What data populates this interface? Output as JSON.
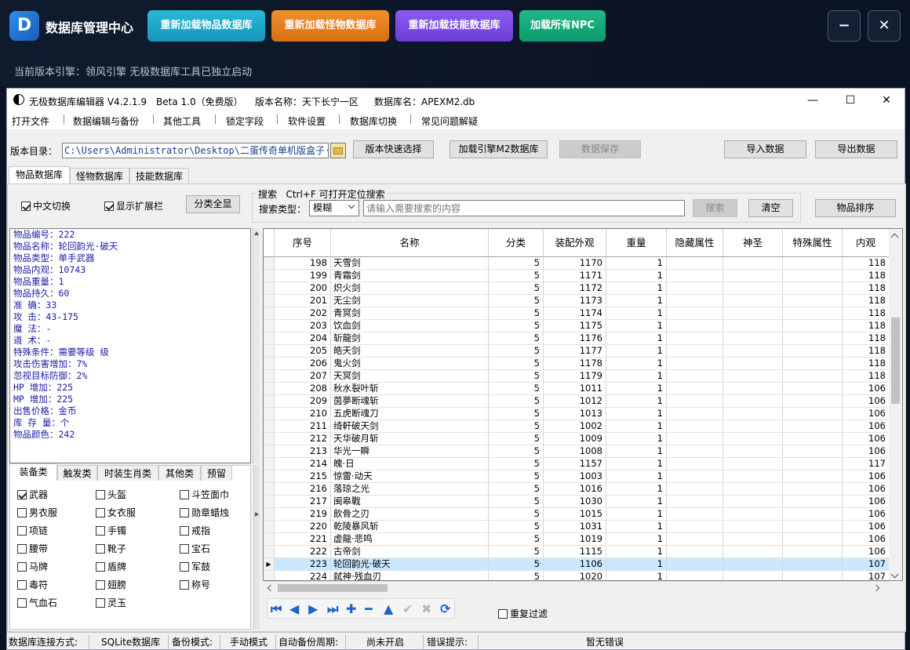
{
  "top": {
    "app_title": "数据库管理中心",
    "logo_letter": "D",
    "buttons": [
      "重新加载物品数据库",
      "重新加载怪物数据库",
      "重新加载技能数据库",
      "加载所有NPC"
    ],
    "minimize": "−",
    "close": "✕",
    "sub_text": "当前版本引擎：领风引擎    无极数据库工具已独立启动",
    "colors": {
      "btn1": "#1aa6c8",
      "btn2": "#e07b1f",
      "btn3": "#7a4ce0",
      "btn4": "#12a77a"
    }
  },
  "window": {
    "title": "无极数据库编辑器 V4.2.1.9",
    "edition": "Beta 1.0（免费版）",
    "version_name": "版本名称：天下长宁一区",
    "db_name": "数据库名：APEXM2.db",
    "win_min": "—",
    "win_max": "☐",
    "win_close": "✕",
    "menu": [
      "打开文件",
      "数据编辑与备份",
      "其他工具",
      "锁定字段",
      "软件设置",
      "数据库切换",
      "常见问题解疑"
    ]
  },
  "toolbar": {
    "dir_label": "版本目录：",
    "dir_path": "C:\\Users\\Administrator\\Desktop\\二蛋传奇单机版盒子·",
    "quick_select": "版本快速选择",
    "load_engine": "加载引擎M2数据库",
    "save": "数据保存",
    "import": "导入数据",
    "export": "导出数据"
  },
  "tabs": [
    "物品数据库",
    "怪物数据库",
    "技能数据库"
  ],
  "options": {
    "cn_switch": "中文切换",
    "show_ext": "显示扩展栏",
    "show_all": "分类全显",
    "search_title": "搜索   Ctrl+F 可打开定位搜索",
    "search_type_label": "搜索类型：",
    "search_type_value": "模糊",
    "search_placeholder": "请输入需要搜索的内容",
    "search_btn": "搜索",
    "clear_btn": "清空",
    "sort_btn": "物品排序"
  },
  "info_lines": [
    "物品编号：222",
    "物品名称：轮回韵光·破天",
    "物品类型：单手武器",
    "物品内观：10743",
    "物品重量：1",
    "物品持久：60",
    "准    确：33",
    "攻    击：43-175",
    "魔    法：-",
    "道    术：-",
    "特殊条件：需要等级  级",
    "攻击伤害增加：7%",
    "忽视目标防御：2%",
    "HP  增加：225",
    "MP  增加：225",
    "出售价格：金币",
    "库 存 量：个",
    "物品颜色：242"
  ],
  "cat_tabs": [
    "装备类",
    "触发类",
    "时装生肖类",
    "其他类",
    "预留"
  ],
  "categories": [
    {
      "label": "武器",
      "checked": true
    },
    {
      "label": "头盔",
      "checked": false
    },
    {
      "label": "斗笠面巾",
      "checked": false
    },
    {
      "label": "男衣服",
      "checked": false
    },
    {
      "label": "女衣服",
      "checked": false
    },
    {
      "label": "勋章蜡烛",
      "checked": false
    },
    {
      "label": "项链",
      "checked": false
    },
    {
      "label": "手镯",
      "checked": false
    },
    {
      "label": "戒指",
      "checked": false
    },
    {
      "label": "腰带",
      "checked": false
    },
    {
      "label": "靴子",
      "checked": false
    },
    {
      "label": "宝石",
      "checked": false
    },
    {
      "label": "马牌",
      "checked": false
    },
    {
      "label": "盾牌",
      "checked": false
    },
    {
      "label": "军鼓",
      "checked": false
    },
    {
      "label": "毒符",
      "checked": false
    },
    {
      "label": "翅膀",
      "checked": false
    },
    {
      "label": "称号",
      "checked": false
    },
    {
      "label": "气血石",
      "checked": false
    },
    {
      "label": "灵玉",
      "checked": false
    }
  ],
  "columns": [
    "序号",
    "名称",
    "分类",
    "装配外观",
    "重量",
    "隐藏属性",
    "神圣",
    "特殊属性",
    "内观"
  ],
  "rows": [
    [
      "198",
      "天雪剑",
      "5",
      "1170",
      "1",
      "118"
    ],
    [
      "199",
      "青霜剑",
      "5",
      "1171",
      "1",
      "118"
    ],
    [
      "200",
      "炽火剑",
      "5",
      "1172",
      "1",
      "118"
    ],
    [
      "201",
      "无尘剑",
      "5",
      "1173",
      "1",
      "118"
    ],
    [
      "202",
      "青冥剑",
      "5",
      "1174",
      "1",
      "118"
    ],
    [
      "203",
      "饮血剑",
      "5",
      "1175",
      "1",
      "118"
    ],
    [
      "204",
      "斩龍剑",
      "5",
      "1176",
      "1",
      "118"
    ],
    [
      "205",
      "皓天剑",
      "5",
      "1177",
      "1",
      "118"
    ],
    [
      "206",
      "鬼火剑",
      "5",
      "1178",
      "1",
      "118"
    ],
    [
      "207",
      "天冥剑",
      "5",
      "1179",
      "1",
      "118"
    ],
    [
      "208",
      "秋水裂叶斩",
      "5",
      "1011",
      "1",
      "106"
    ],
    [
      "209",
      "茵夢断魂斩",
      "5",
      "1012",
      "1",
      "106"
    ],
    [
      "210",
      "五虎断魂刀",
      "5",
      "1013",
      "1",
      "106"
    ],
    [
      "211",
      "绮軒破天剑",
      "5",
      "1002",
      "1",
      "106"
    ],
    [
      "212",
      "天华破月斩",
      "5",
      "1009",
      "1",
      "106"
    ],
    [
      "213",
      "华光一瞬",
      "5",
      "1008",
      "1",
      "106"
    ],
    [
      "214",
      "魄·日",
      "5",
      "1157",
      "1",
      "117"
    ],
    [
      "215",
      "惊雷·动天",
      "5",
      "1003",
      "1",
      "106"
    ],
    [
      "216",
      "落琼之光",
      "5",
      "1016",
      "1",
      "106"
    ],
    [
      "217",
      "闽皋戰",
      "5",
      "1030",
      "1",
      "106"
    ],
    [
      "219",
      "飲骨之刃",
      "5",
      "1015",
      "1",
      "106"
    ],
    [
      "220",
      "乾陵暴风斩",
      "5",
      "1031",
      "1",
      "106"
    ],
    [
      "221",
      "虚龍·悲鸣",
      "5",
      "1019",
      "1",
      "106"
    ],
    [
      "222",
      "古帝剑",
      "5",
      "1115",
      "1",
      "106"
    ],
    [
      "223",
      "轮回韵光·破天",
      "5",
      "1106",
      "1",
      "107"
    ],
    [
      "224",
      "弑神·残血刃",
      "5",
      "1020",
      "1",
      "107"
    ]
  ],
  "selected_row": "223",
  "bottom": {
    "dup_filter": "重复过滤"
  },
  "status": {
    "conn_label": "数据库连接方式:",
    "conn_value": "SQLite数据库",
    "backup_label": "备份模式:",
    "backup_value": "手动模式",
    "auto_label": "自动备份周期:",
    "auto_value": "尚未开启",
    "err_label": "错误提示:",
    "err_value": "暂无错误"
  }
}
